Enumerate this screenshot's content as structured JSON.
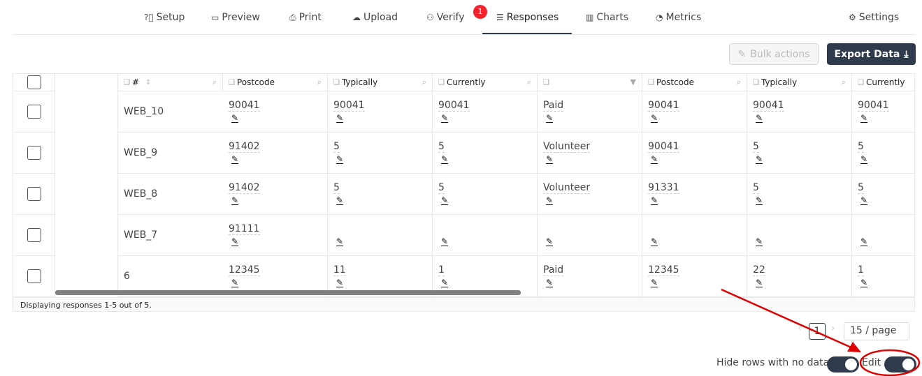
{
  "nav": {
    "tabs": [
      {
        "label": "Setup",
        "icon": "question-circle-icon",
        "glyph": "?⃝"
      },
      {
        "label": "Preview",
        "icon": "presentation-icon",
        "glyph": "▭"
      },
      {
        "label": "Print",
        "icon": "printer-icon",
        "glyph": "⎙"
      },
      {
        "label": "Upload",
        "icon": "cloud-upload-icon",
        "glyph": "☁"
      },
      {
        "label": "Verify",
        "icon": "user-edit-icon",
        "glyph": "⚇"
      },
      {
        "label": "Responses",
        "icon": "list-icon",
        "glyph": "☰"
      },
      {
        "label": "Charts",
        "icon": "bar-chart-icon",
        "glyph": "▥"
      },
      {
        "label": "Metrics",
        "icon": "dashboard-icon",
        "glyph": "◔"
      },
      {
        "label": "Settings",
        "icon": "gears-icon",
        "glyph": "⚙"
      }
    ],
    "active": "Responses",
    "verify_badge": "1"
  },
  "toolbar": {
    "bulk_label": "Bulk actions",
    "export_label": "Export Data"
  },
  "table": {
    "columns": [
      "#",
      "Postcode",
      "Typically",
      "Currently",
      "",
      "Postcode",
      "Typically",
      "Currently"
    ],
    "rows": [
      {
        "id": "WEB_10",
        "cells": [
          "90041",
          "90041",
          "90041",
          "Paid",
          "90041",
          "90041",
          "90041"
        ]
      },
      {
        "id": "WEB_9",
        "cells": [
          "91402",
          "5",
          "5",
          "Volunteer",
          "90041",
          "5",
          "5"
        ]
      },
      {
        "id": "WEB_8",
        "cells": [
          "91402",
          "5",
          "5",
          "Volunteer",
          "91331",
          "5",
          "5"
        ]
      },
      {
        "id": "WEB_7",
        "cells": [
          "91111",
          "",
          "",
          "",
          "",
          "",
          ""
        ]
      },
      {
        "id": "6",
        "cells": [
          "12345",
          "11",
          "1",
          "Paid",
          "12345",
          "22",
          "1"
        ]
      }
    ],
    "footer": "Displaying responses 1-5 out of 5."
  },
  "pagination": {
    "current": "1",
    "page_size": "15 / page"
  },
  "toggles": {
    "hide_rows_label": "Hide rows with no data",
    "hide_rows_on": true,
    "edit_label": "Edit",
    "edit_on": true
  },
  "colors": {
    "primary": "#2f3b4c",
    "badge": "#f5222d",
    "annotation": "#e00000"
  }
}
